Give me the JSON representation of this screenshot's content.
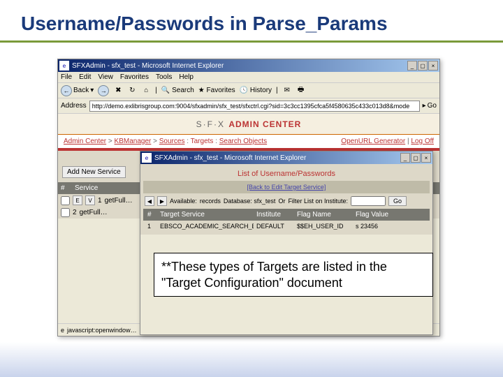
{
  "slide": {
    "title": "Username/Passwords in Parse_Params"
  },
  "win1": {
    "title": "SFXAdmin - sfx_test - Microsoft Internet Explorer",
    "menu": [
      "File",
      "Edit",
      "View",
      "Favorites",
      "Tools",
      "Help"
    ],
    "toolbar": {
      "back": "Back",
      "search": "Search",
      "favorites": "Favorites",
      "history": "History"
    },
    "address_label": "Address",
    "url": "http://demo.exlibrisgroup.com:9004/sfxadmin/sfx_test/sfxctrl.cgi?sid=3c3cc1395cfca5f4580635c433c013d8&mode",
    "go": "Go",
    "sfx_logo": "S·F·X",
    "admin_center": "ADMIN CENTER",
    "breadcrumb": {
      "admin_center": "Admin Center",
      "kbmanager": "KBManager",
      "sources": "Sources",
      "targets": "Targets",
      "search_objects": "Search Objects"
    },
    "right_links": {
      "openurl": "OpenURL Generator",
      "logoff": "Log Off"
    },
    "add_service": "Add New Service",
    "table_header": {
      "num": "#",
      "service": "Service"
    },
    "rows": [
      {
        "num": "1",
        "service": "getFull…"
      },
      {
        "num": "2",
        "service": "getFull…"
      }
    ],
    "status": "javascript:openwindow…"
  },
  "win2": {
    "title": "SFXAdmin - sfx_test - Microsoft Internet Explorer",
    "list_title": "List of Username/Passwords",
    "back": "[Back to Edit Target Service]",
    "filter": {
      "available": "Available:",
      "records": "records",
      "database": "Database: sfx_test",
      "or": "Or",
      "filter_label": "Filter List on Institute:",
      "go": "Go"
    },
    "table_header": {
      "num": "#",
      "target_service": "Target Service",
      "institute": "Institute",
      "flag_name": "Flag Name",
      "flag_value": "Flag Value"
    },
    "row1": {
      "num": "1",
      "target_service": "EBSCO_ACADEMIC_SEARCH_ELITE getFull…",
      "institute": "DEFAULT",
      "flag_name": "$$EH_USER_ID",
      "flag_value": "s 23456"
    }
  },
  "note": "**These types of Targets are listed in the \"Target Configuration\" document"
}
